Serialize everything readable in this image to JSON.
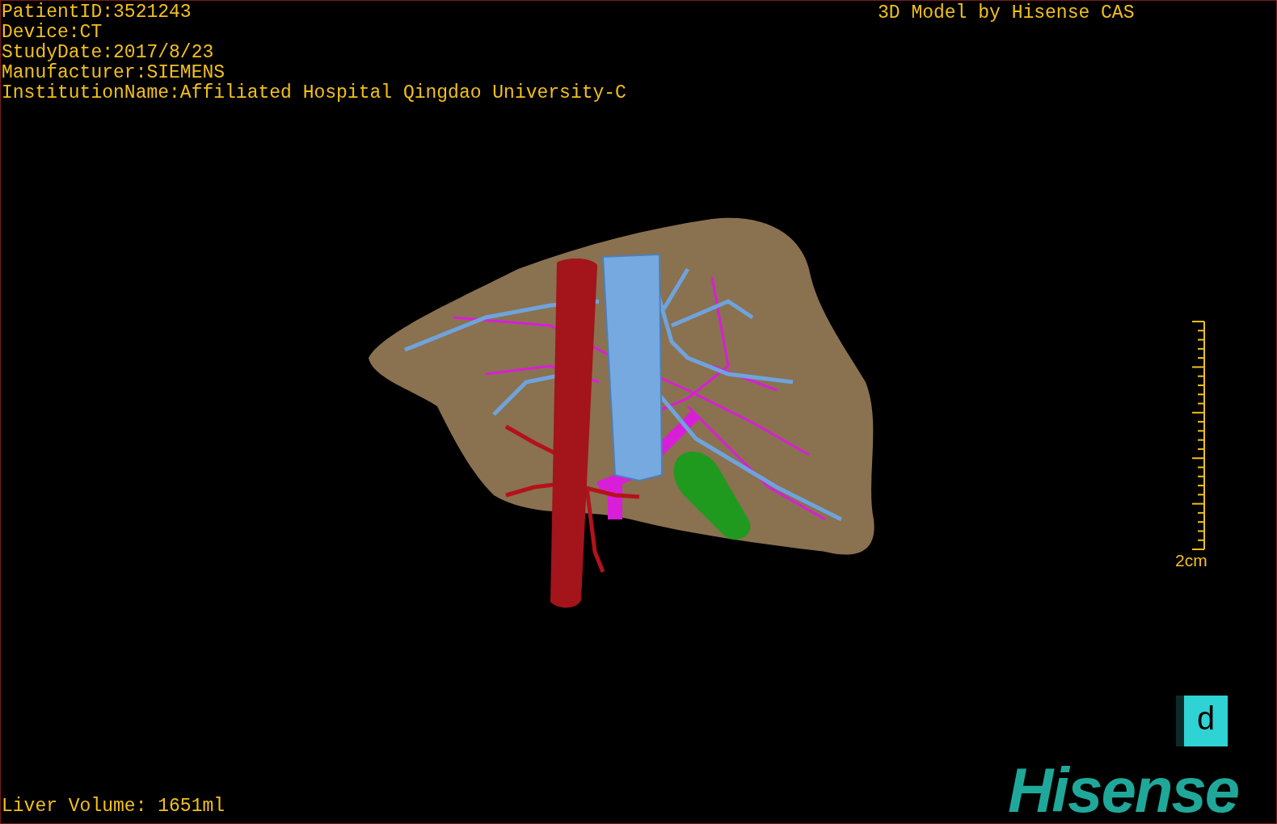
{
  "study_info": [
    "PatientID:3521243",
    "Device:CT",
    "StudyDate:2017/8/23",
    "Manufacturer:SIEMENS",
    "InstitutionName:Affiliated Hospital Qingdao University-C"
  ],
  "model_credit": "3D Model by Hisense CAS",
  "scale_bar": {
    "label": "2cm"
  },
  "liver_volume": "Liver Volume: 1651ml",
  "view_button": {
    "label": "d"
  },
  "logo": "Hisense"
}
